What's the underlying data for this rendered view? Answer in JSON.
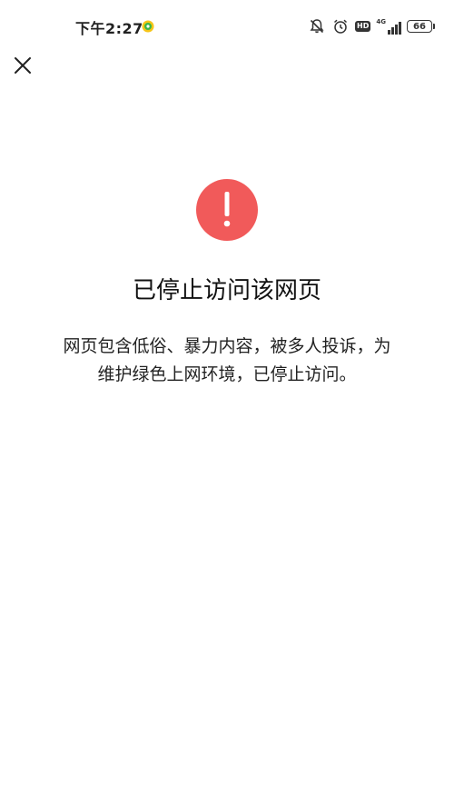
{
  "status_bar": {
    "time": "下午2:27",
    "network_label": "4G",
    "battery_level": "66"
  },
  "page": {
    "title": "已停止访问该网页",
    "description_line1": "网页包含低俗、暴力内容，被多人投诉，为",
    "description_line2": "维护绿色上网环境，已停止访问。"
  },
  "colors": {
    "warning_red": "#f15a5a",
    "background": "#ffffff",
    "text": "#111111"
  }
}
